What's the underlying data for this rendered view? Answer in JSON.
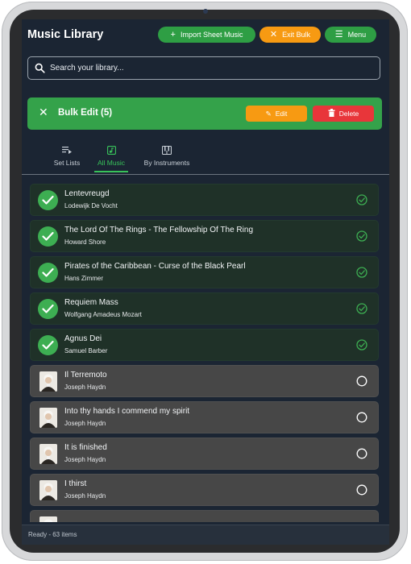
{
  "header": {
    "title": "Music Library",
    "import_label": "Import Sheet Music",
    "exit_label": "Exit Bulk",
    "menu_label": "Menu"
  },
  "search": {
    "placeholder": "Search your library..."
  },
  "bulk_bar": {
    "title": "Bulk Edit (5)",
    "edit_label": "Edit",
    "delete_label": "Delete"
  },
  "tabs": [
    {
      "label": "Set Lists",
      "icon": "playlist-icon",
      "active": false
    },
    {
      "label": "All Music",
      "icon": "music-note-icon",
      "active": true
    },
    {
      "label": "By Instruments",
      "icon": "piano-icon",
      "active": false
    }
  ],
  "items": [
    {
      "title": "Lentevreugd",
      "composer": "Lodewijk De Vocht",
      "selected": true
    },
    {
      "title": "The Lord Of The Rings - The Fellowship Of The Ring",
      "composer": "Howard Shore",
      "selected": true
    },
    {
      "title": "Pirates of the Caribbean - Curse of the Black Pearl",
      "composer": "Hans Zimmer",
      "selected": true
    },
    {
      "title": "Requiem Mass",
      "composer": "Wolfgang Amadeus Mozart",
      "selected": true
    },
    {
      "title": "Agnus Dei",
      "composer": "Samuel Barber",
      "selected": true
    },
    {
      "title": "Il Terremoto",
      "composer": "Joseph Haydn",
      "selected": false
    },
    {
      "title": "Into thy hands I commend my spirit",
      "composer": "Joseph Haydn",
      "selected": false
    },
    {
      "title": "It is finished",
      "composer": "Joseph Haydn",
      "selected": false
    },
    {
      "title": "I thirst",
      "composer": "Joseph Haydn",
      "selected": false
    },
    {
      "title": "",
      "composer": "",
      "selected": false
    }
  ],
  "status": {
    "text": "Ready - 63 items"
  },
  "colors": {
    "accent_green": "#34a24a",
    "accent_orange": "#f79a12",
    "danger_red": "#e8363a",
    "background": "#1b2533"
  }
}
